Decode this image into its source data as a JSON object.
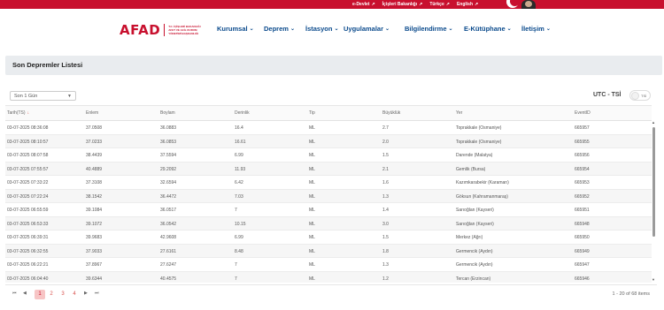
{
  "topbar": {
    "links": [
      {
        "label": "e-Devlet",
        "icon": "external-link-icon"
      },
      {
        "label": "İçişleri Bakanlığı",
        "icon": "external-link-icon"
      },
      {
        "label": "Türkçe",
        "icon": "external-link-icon"
      },
      {
        "label": "English",
        "icon": "external-link-icon"
      }
    ],
    "color": "#c8102e"
  },
  "logo": {
    "text": "AFAD",
    "subtitle": "T.C. İÇİŞLERİ BAKANLIĞI AFET VE ACİL DURUM YÖNETİMİ BAŞKANLIĞI"
  },
  "nav": {
    "items": [
      {
        "label": "Kurumsal"
      },
      {
        "label": "Deprem"
      },
      {
        "label": "İstasyon"
      },
      {
        "label": "Uygulamalar"
      },
      {
        "label": "Bilgilendirme"
      },
      {
        "label": "E-Kütüphane"
      },
      {
        "label": "İletişim"
      }
    ],
    "color": "#0a4a8c"
  },
  "page": {
    "title": "Son Depremler Listesi"
  },
  "filter": {
    "selected": "Son 1 Gün"
  },
  "timezone": {
    "label": "UTC - TSİ",
    "toggle_label": "TSİ"
  },
  "table": {
    "columns": [
      "Tarih(TS)",
      "Enlem",
      "Boylam",
      "Derinlik",
      "Tip",
      "Büyüklük",
      "Yer",
      "EventID"
    ],
    "sort_indicator": "↓",
    "rows": [
      [
        "03-07-2025 08:36:08",
        "37.0508",
        "36.0883",
        "16.4",
        "ML",
        "2.7",
        "Toprakkale (Osmaniye)",
        "665957"
      ],
      [
        "03-07-2025 08:10:57",
        "37.0233",
        "36.0853",
        "16.61",
        "ML",
        "2.0",
        "Toprakkale (Osmaniye)",
        "665955"
      ],
      [
        "03-07-2025 08:07:58",
        "38.4439",
        "37.5594",
        "6.99",
        "ML",
        "1.5",
        "Darende (Malatya)",
        "665956"
      ],
      [
        "03-07-2025 07:55:57",
        "40.4889",
        "29.2092",
        "11.93",
        "ML",
        "2.1",
        "Gemlik (Bursa)",
        "665954"
      ],
      [
        "03-07-2025 07:33:22",
        "37.3108",
        "32.6594",
        "6.42",
        "ML",
        "1.6",
        "Kazımkarabekir (Karaman)",
        "665953"
      ],
      [
        "03-07-2025 07:22:24",
        "38.1542",
        "36.4472",
        "7.03",
        "ML",
        "1.3",
        "Göksun (Kahramanmaraş)",
        "665952"
      ],
      [
        "03-07-2025 06:55:59",
        "39.1084",
        "36.0517",
        "7",
        "ML",
        "1.4",
        "Sarıoğlan (Kayseri)",
        "665951"
      ],
      [
        "03-07-2025 06:53:33",
        "39.1072",
        "36.0542",
        "10.15",
        "ML",
        "3.0",
        "Sarıoğlan (Kayseri)",
        "665948"
      ],
      [
        "03-07-2025 06:39:31",
        "39.9683",
        "42.9608",
        "6.99",
        "ML",
        "1.5",
        "Merkez (Ağrı)",
        "665950"
      ],
      [
        "03-07-2025 06:32:55",
        "37.9033",
        "27.6161",
        "8.48",
        "ML",
        "1.8",
        "Germencik (Aydın)",
        "665949"
      ],
      [
        "03-07-2025 06:22:21",
        "37.8967",
        "27.6247",
        "7",
        "ML",
        "1.3",
        "Germencik (Aydın)",
        "665947"
      ],
      [
        "03-07-2025 06:04:40",
        "39.6344",
        "40.4575",
        "7",
        "ML",
        "1.2",
        "Tercan (Erzincan)",
        "665946"
      ]
    ]
  },
  "pager": {
    "first": "⏮",
    "prev": "◀",
    "next": "▶",
    "last": "⏭",
    "pages": [
      "1",
      "2",
      "3",
      "4"
    ],
    "active_page": "1",
    "info": "1 - 20 of 68 items"
  }
}
